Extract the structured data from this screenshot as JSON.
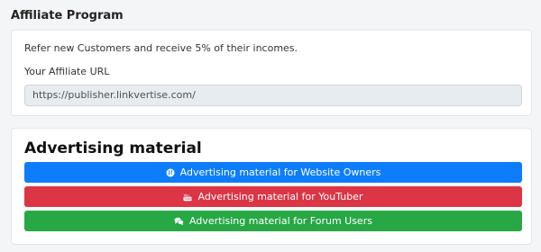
{
  "affiliate": {
    "title": "Affiliate Program",
    "intro": "Refer new Customers and receive 5% of their incomes.",
    "url_label": "Your Affiliate URL",
    "url_value": "https://publisher.linkvertise.com/"
  },
  "material": {
    "title": "Advertising material",
    "buttons": [
      {
        "label": "Advertising material for Website Owners",
        "icon": "globe-icon",
        "color": "#0d7dfb"
      },
      {
        "label": "Advertising material for YouTuber",
        "icon": "youtube-icon",
        "color": "#dc3545"
      },
      {
        "label": "Advertising material for Forum Users",
        "icon": "chat-icon",
        "color": "#28a745"
      }
    ]
  }
}
